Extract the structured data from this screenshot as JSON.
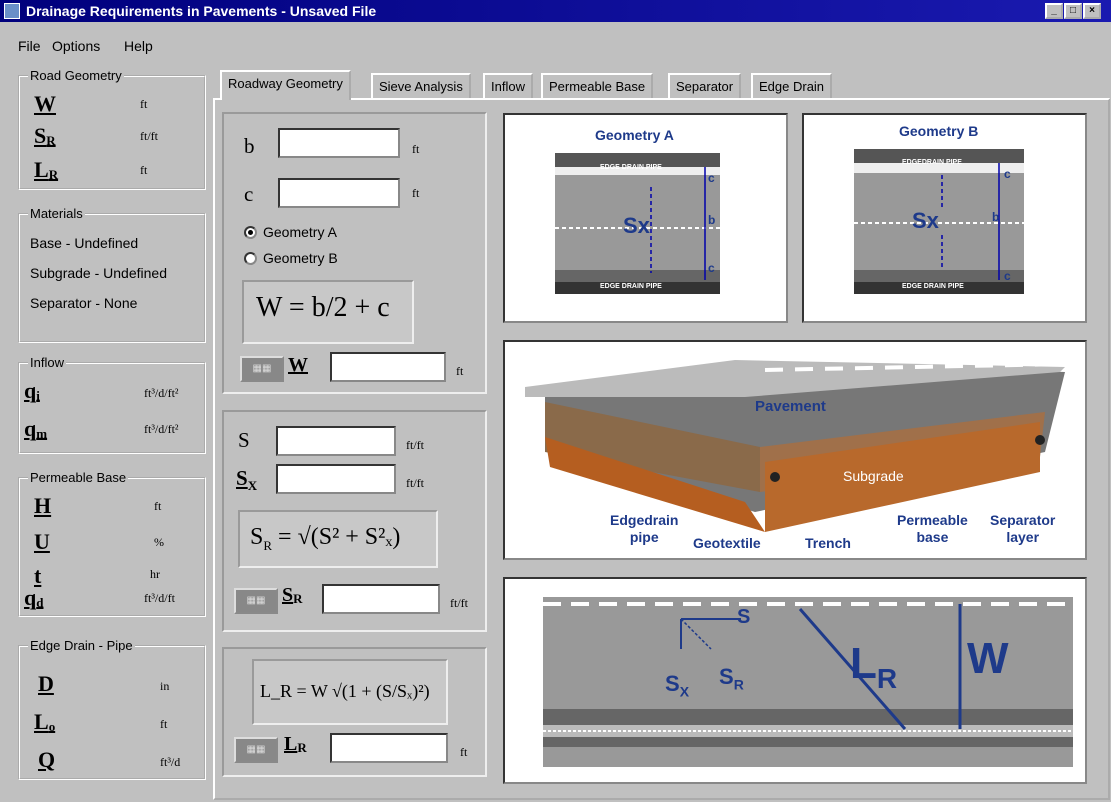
{
  "window": {
    "title": "Drainage Requirements in Pavements - Unsaved File"
  },
  "menu": {
    "file": "File",
    "options": "Options",
    "help": "Help"
  },
  "road_geometry": {
    "title": "Road Geometry",
    "items": [
      {
        "sym": "W",
        "sub": "",
        "unit": "ft"
      },
      {
        "sym": "S",
        "sub": "R",
        "unit": "ft/ft"
      },
      {
        "sym": "L",
        "sub": "R",
        "unit": "ft"
      }
    ]
  },
  "materials": {
    "title": "Materials",
    "base": "Base - Undefined",
    "subgrade": "Subgrade - Undefined",
    "separator": "Separator - None"
  },
  "inflow": {
    "title": "Inflow",
    "items": [
      {
        "sym": "q",
        "sub": "i",
        "unit": "ft³/d/ft²"
      },
      {
        "sym": "q",
        "sub": "m",
        "unit": "ft³/d/ft²"
      }
    ]
  },
  "permeable_base": {
    "title": "Permeable Base",
    "items": [
      {
        "sym": "H",
        "sub": "",
        "unit": "ft"
      },
      {
        "sym": "U",
        "sub": "",
        "unit": "%"
      },
      {
        "sym": "t",
        "sub": "",
        "unit": "hr"
      },
      {
        "sym": "q",
        "sub": "d",
        "unit": "ft³/d/ft"
      }
    ]
  },
  "edge_drain": {
    "title": "Edge Drain - Pipe",
    "items": [
      {
        "sym": "D",
        "sub": "",
        "unit": "in"
      },
      {
        "sym": "L",
        "sub": "o",
        "unit": "ft"
      },
      {
        "sym": "Q",
        "sub": "",
        "unit": "ft³/d"
      }
    ]
  },
  "tabs": [
    "Roadway Geometry",
    "Sieve Analysis",
    "Inflow",
    "Permeable Base",
    "Separator",
    "Edge Drain"
  ],
  "w_section": {
    "b_label": "b",
    "c_label": "c",
    "unit_ft": "ft",
    "b_value": "",
    "c_value": "",
    "geometry_a": "Geometry A",
    "geometry_b": "Geometry B",
    "formula": "W = b/2 + c",
    "result_label": "W",
    "result_value": "",
    "result_unit": "ft",
    "calc_icon": "calculator-icon"
  },
  "sr_section": {
    "s_label": "S",
    "sx_label": "S",
    "sx_sub": "X",
    "unit": "ft/ft",
    "s_value": "",
    "sx_value": "",
    "formula_lhs": "S",
    "formula_lhs_sub": "R",
    "formula_rhs": "= √(S² + S²ₓ)",
    "result_label": "S",
    "result_sub": "R",
    "result_value": "",
    "result_unit": "ft/ft"
  },
  "lr_section": {
    "formula": "L_R = W √(1 + (S/Sₓ)²)",
    "result_label": "L",
    "result_sub": "R",
    "result_value": "",
    "result_unit": "ft"
  },
  "figures": {
    "geo_a_title": "Geometry A",
    "geo_b_title": "Geometry B",
    "edge_drain_pipe": "EDGE DRAIN PIPE",
    "edgedrain_pipe": "EDGEDRAIN PIPE",
    "sx": "Sx",
    "b": "b",
    "c": "c",
    "pavement": "Pavement",
    "subgrade": "Subgrade",
    "edgedrain": "Edgedrain",
    "pipe": "pipe",
    "geotextile": "Geotextile",
    "trench": "Trench",
    "permeable": "Permeable",
    "base": "base",
    "separator": "Separator",
    "layer": "layer",
    "s": "S",
    "sr": "S",
    "sr_sub": "R",
    "sx_big": "S",
    "sx_sub": "X",
    "lr": "L",
    "lr_sub": "R",
    "w": "W"
  }
}
